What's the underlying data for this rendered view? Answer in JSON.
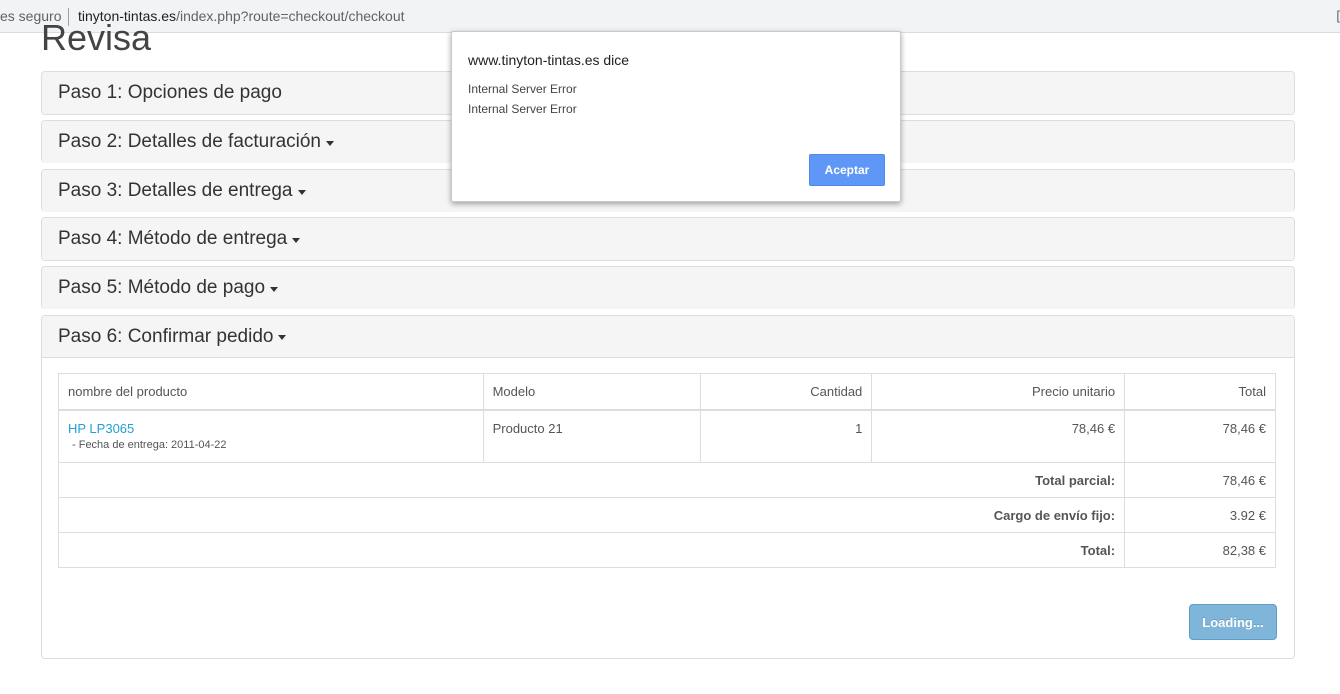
{
  "browser": {
    "security_text": "es seguro",
    "url_host": "tinyton-tintas.es",
    "url_path": "/index.php?route=checkout/checkout",
    "edge_glyph": "["
  },
  "page": {
    "title": "Revisa"
  },
  "steps": [
    {
      "label": "Paso 1: Opciones de pago",
      "has_caret": false
    },
    {
      "label": "Paso 2: Detalles de facturación",
      "has_caret": true
    },
    {
      "label": "Paso 3: Detalles de entrega",
      "has_caret": true
    },
    {
      "label": "Paso 4: Método de entrega",
      "has_caret": true
    },
    {
      "label": "Paso 5: Método de pago",
      "has_caret": true
    },
    {
      "label": "Paso 6: Confirmar pedido",
      "has_caret": true
    }
  ],
  "order_table": {
    "headers": {
      "product": "nombre del producto",
      "model": "Modelo",
      "quantity": "Cantidad",
      "unit_price": "Precio unitario",
      "total": "Total"
    },
    "items": [
      {
        "name": "HP LP3065",
        "option": "- Fecha de entrega: 2011-04-22",
        "model": "Producto 21",
        "quantity": "1",
        "unit_price": "78,46 €",
        "total": "78,46 €"
      }
    ],
    "totals": [
      {
        "label": "Total parcial:",
        "value": "78,46 €"
      },
      {
        "label": "Cargo de envío fijo:",
        "value": "3.92 €"
      },
      {
        "label": "Total:",
        "value": "82,38 €"
      }
    ]
  },
  "confirm_button_label": "Loading...",
  "dialog": {
    "title": "www.tinyton-tintas.es dice",
    "line1": "Internal Server Error",
    "line2": "Internal Server Error",
    "ok_label": "Aceptar"
  },
  "colors": {
    "link": "#23a1d1",
    "panel_heading_bg": "#f5f5f5",
    "loading_button": "#7fb5d9",
    "dialog_button": "#5e97f6"
  }
}
